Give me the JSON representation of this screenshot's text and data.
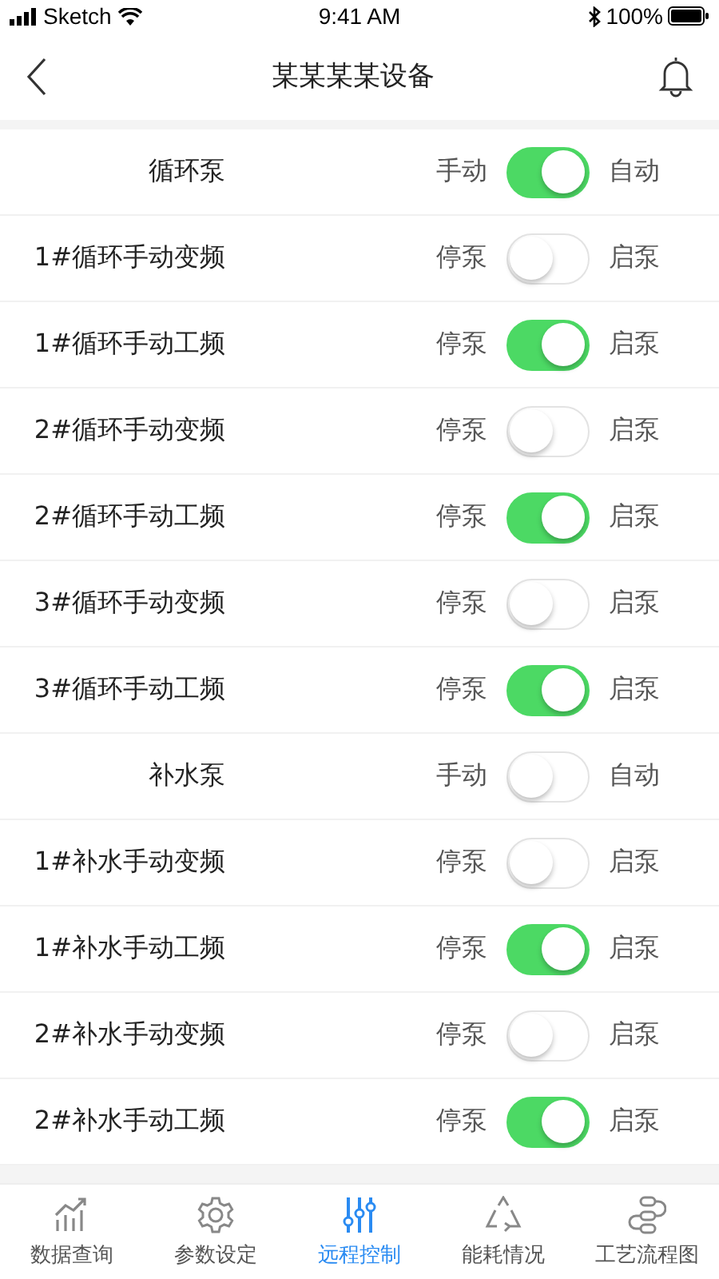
{
  "status_bar": {
    "carrier": "Sketch",
    "time": "9:41 AM",
    "battery": "100%"
  },
  "nav": {
    "title": "某某某某设备"
  },
  "rows": [
    {
      "label": "循环泵",
      "off_label": "手动",
      "on_label": "自动",
      "on": true
    },
    {
      "label": "1#循环手动变频",
      "off_label": "停泵",
      "on_label": "启泵",
      "on": false
    },
    {
      "label": "1#循环手动工频",
      "off_label": "停泵",
      "on_label": "启泵",
      "on": true
    },
    {
      "label": "2#循环手动变频",
      "off_label": "停泵",
      "on_label": "启泵",
      "on": false
    },
    {
      "label": "2#循环手动工频",
      "off_label": "停泵",
      "on_label": "启泵",
      "on": true
    },
    {
      "label": "3#循环手动变频",
      "off_label": "停泵",
      "on_label": "启泵",
      "on": false
    },
    {
      "label": "3#循环手动工频",
      "off_label": "停泵",
      "on_label": "启泵",
      "on": true
    },
    {
      "label": "补水泵",
      "off_label": "手动",
      "on_label": "自动",
      "on": false
    },
    {
      "label": "1#补水手动变频",
      "off_label": "停泵",
      "on_label": "启泵",
      "on": false
    },
    {
      "label": "1#补水手动工频",
      "off_label": "停泵",
      "on_label": "启泵",
      "on": true
    },
    {
      "label": "2#补水手动变频",
      "off_label": "停泵",
      "on_label": "启泵",
      "on": false
    },
    {
      "label": "2#补水手动工频",
      "off_label": "停泵",
      "on_label": "启泵",
      "on": true
    }
  ],
  "tabs": [
    {
      "label": "数据查询",
      "kind": "chart",
      "selected": false
    },
    {
      "label": "参数设定",
      "kind": "gear",
      "selected": false
    },
    {
      "label": "远程控制",
      "kind": "sliders",
      "selected": true
    },
    {
      "label": "能耗情况",
      "kind": "recycle",
      "selected": false
    },
    {
      "label": "工艺流程图",
      "kind": "flow",
      "selected": false
    }
  ]
}
